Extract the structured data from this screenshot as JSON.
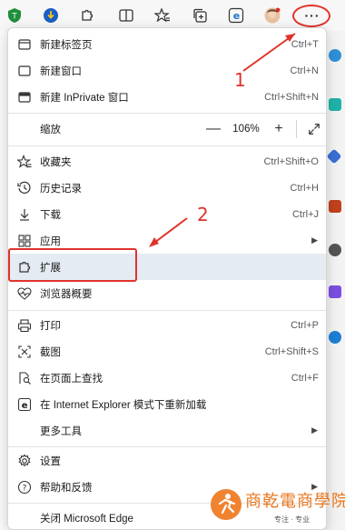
{
  "menu": {
    "new_tab": {
      "label": "新建标签页",
      "shortcut": "Ctrl+T"
    },
    "new_window": {
      "label": "新建窗口",
      "shortcut": "Ctrl+N"
    },
    "new_inprivate": {
      "label": "新建 InPrivate 窗口",
      "shortcut": "Ctrl+Shift+N"
    },
    "zoom": {
      "label": "缩放",
      "minus": "—",
      "value": "106%",
      "plus": "+"
    },
    "favorites": {
      "label": "收藏夹",
      "shortcut": "Ctrl+Shift+O"
    },
    "history": {
      "label": "历史记录",
      "shortcut": "Ctrl+H"
    },
    "downloads": {
      "label": "下载",
      "shortcut": "Ctrl+J"
    },
    "apps": {
      "label": "应用"
    },
    "extensions": {
      "label": "扩展"
    },
    "browser_essentials": {
      "label": "浏览器概要"
    },
    "print": {
      "label": "打印",
      "shortcut": "Ctrl+P"
    },
    "screenshot": {
      "label": "截图",
      "shortcut": "Ctrl+Shift+S"
    },
    "find": {
      "label": "在页面上查找",
      "shortcut": "Ctrl+F"
    },
    "ie_mode": {
      "label": "在 Internet Explorer 模式下重新加载"
    },
    "more_tools": {
      "label": "更多工具"
    },
    "settings": {
      "label": "设置"
    },
    "help": {
      "label": "帮助和反馈"
    },
    "close": {
      "label": "关闭 Microsoft Edge"
    }
  },
  "annotations": {
    "step1": "1",
    "step2": "2"
  },
  "toolbar": {
    "more_label": "···"
  },
  "watermark": {
    "title": "商乾電商學院",
    "subtitle": "专注 · 专业"
  },
  "colors": {
    "annotation": "#e0322b",
    "highlight": "#e5ebf2",
    "watermark": "#e8761e"
  }
}
